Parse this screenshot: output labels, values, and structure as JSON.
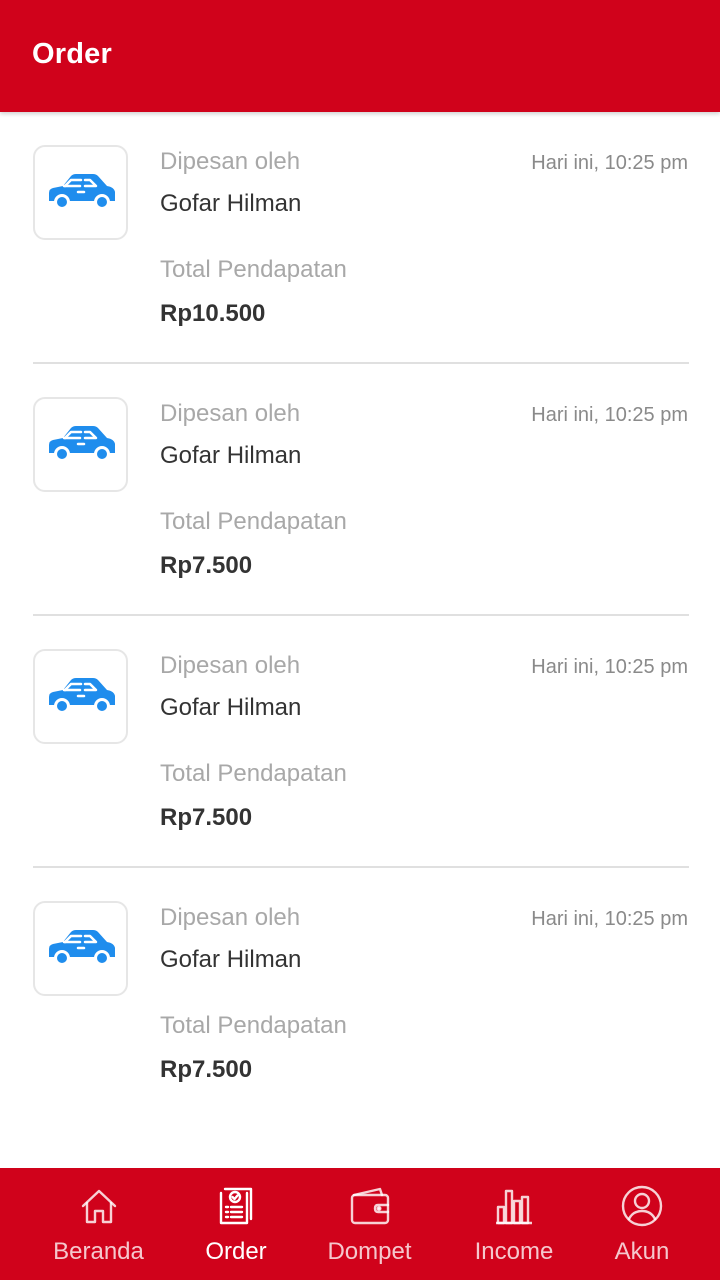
{
  "app_bar": {
    "title": "Order"
  },
  "colors": {
    "primary": "#d0021b",
    "car_icon": "#1f8ded",
    "divider": "#e0e0e0"
  },
  "orders": [
    {
      "service_icon": "car-icon",
      "ordered_by_label": "Dipesan oleh",
      "customer": "Gofar Hilman",
      "time": "Hari ini, 10:25 pm",
      "earnings_label": "Total Pendapatan",
      "earnings": "Rp10.500"
    },
    {
      "service_icon": "car-icon",
      "ordered_by_label": "Dipesan oleh",
      "customer": "Gofar Hilman",
      "time": "Hari ini, 10:25 pm",
      "earnings_label": "Total Pendapatan",
      "earnings": "Rp7.500"
    },
    {
      "service_icon": "car-icon",
      "ordered_by_label": "Dipesan oleh",
      "customer": "Gofar Hilman",
      "time": "Hari ini, 10:25 pm",
      "earnings_label": "Total Pendapatan",
      "earnings": "Rp7.500"
    },
    {
      "service_icon": "car-icon",
      "ordered_by_label": "Dipesan oleh",
      "customer": "Gofar Hilman",
      "time": "Hari ini, 10:25 pm",
      "earnings_label": "Total Pendapatan",
      "earnings": "Rp7.500"
    }
  ],
  "bottom_nav": {
    "active": "Order",
    "items": [
      {
        "label": "Beranda",
        "icon": "home-icon"
      },
      {
        "label": "Order",
        "icon": "order-list-icon"
      },
      {
        "label": "Dompet",
        "icon": "wallet-icon"
      },
      {
        "label": "Income",
        "icon": "bar-chart-icon"
      },
      {
        "label": "Akun",
        "icon": "account-icon"
      }
    ]
  }
}
